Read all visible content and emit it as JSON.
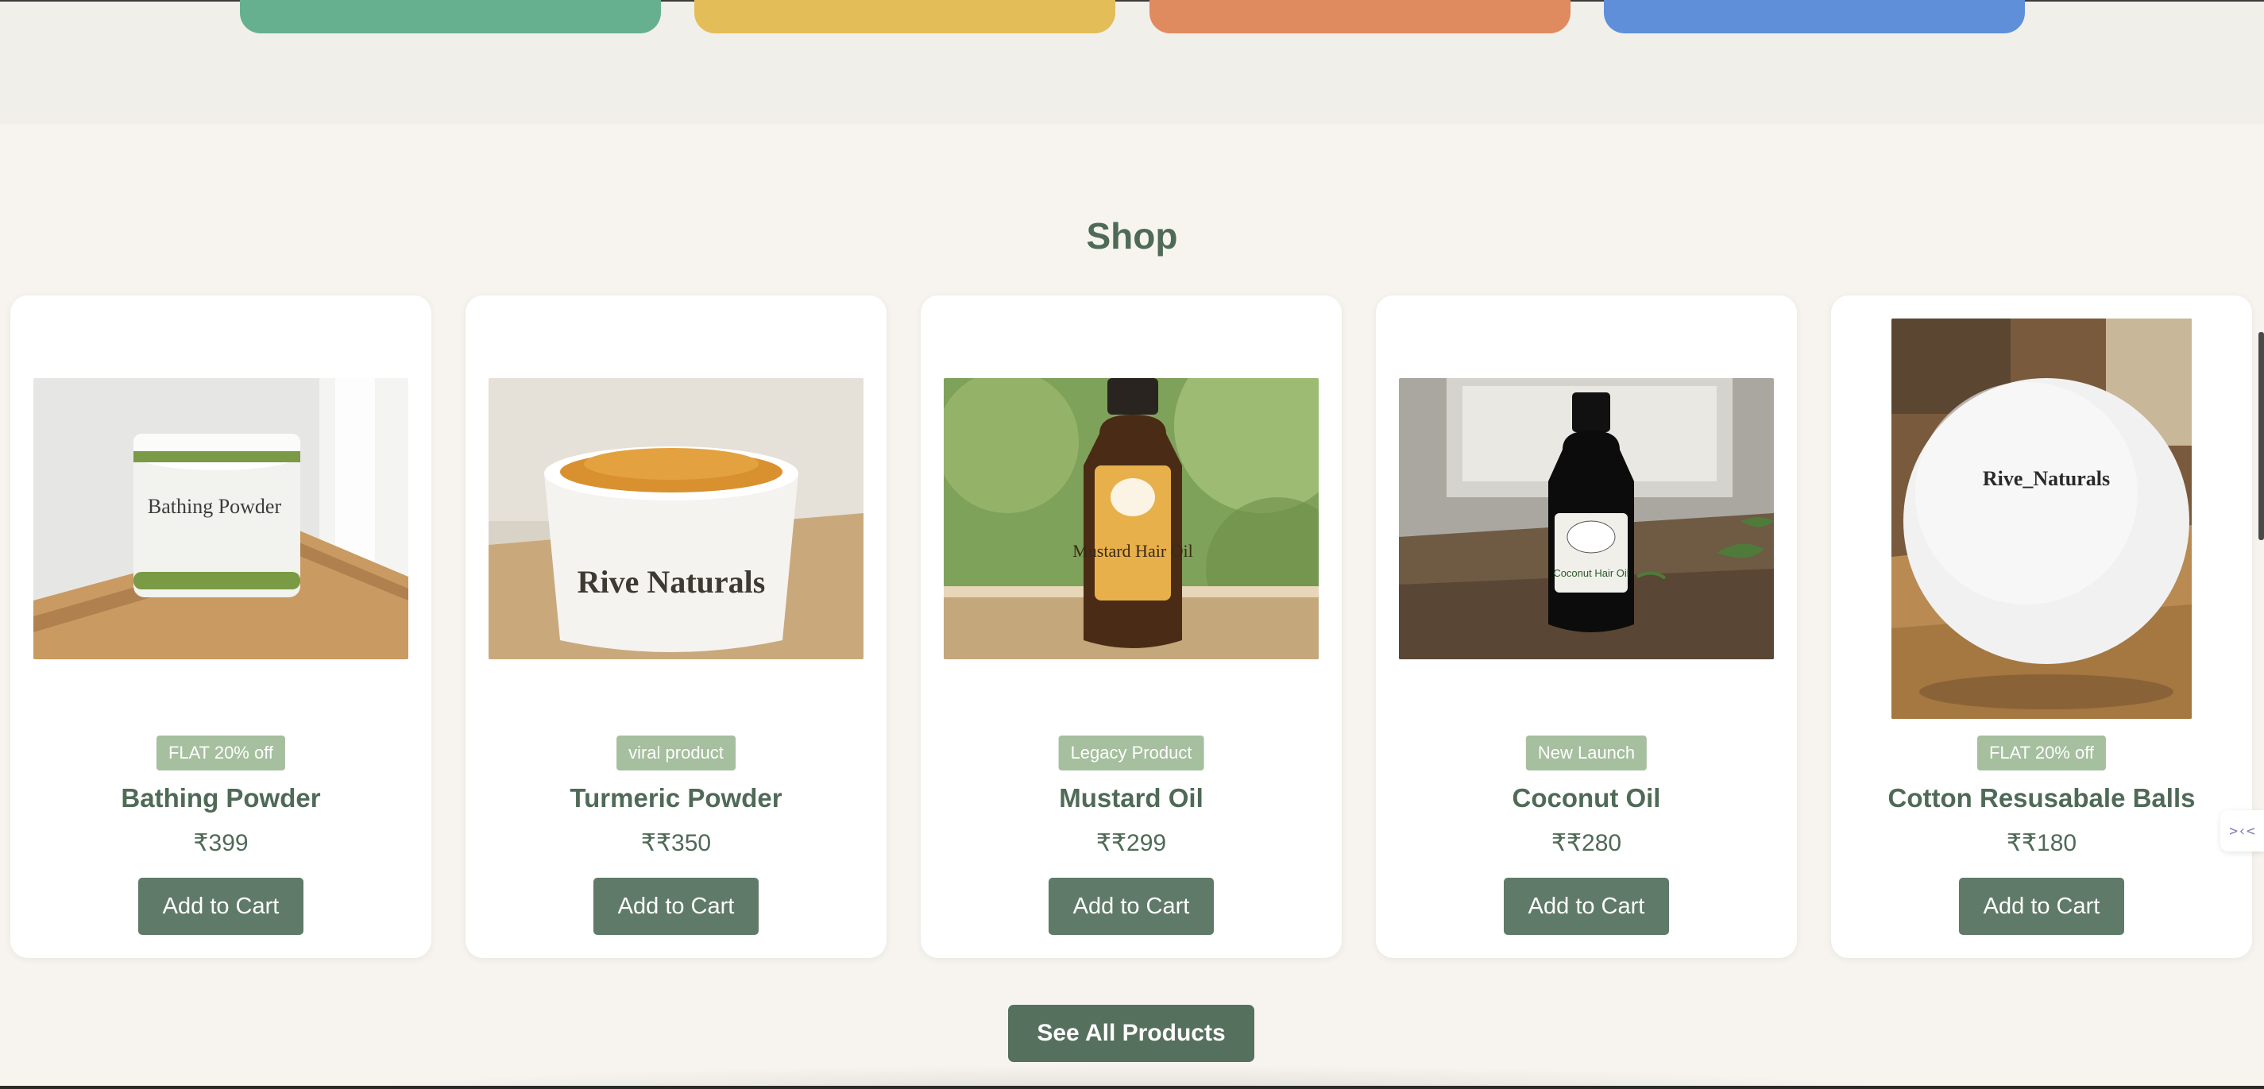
{
  "category_cards": [
    {
      "color": "#66b08f"
    },
    {
      "color": "#e3bd57"
    },
    {
      "color": "#e08a5f"
    },
    {
      "color": "#5f8fd9"
    }
  ],
  "shop": {
    "title": "Shop",
    "products": [
      {
        "name": "Bathing Powder",
        "badge": "FLAT 20% off",
        "price": "₹399",
        "button_label": "Add to Cart",
        "image_icon": "bathing-powder-jar-image",
        "image_label": "Bathing Powder"
      },
      {
        "name": "Turmeric Powder",
        "badge": "viral product",
        "price": "₹₹350",
        "button_label": "Add to Cart",
        "image_icon": "turmeric-powder-jar-image",
        "image_label": "Rive Naturals"
      },
      {
        "name": "Mustard Oil",
        "badge": "Legacy Product",
        "price": "₹₹299",
        "button_label": "Add to Cart",
        "image_icon": "mustard-oil-bottle-image",
        "image_label": "Mustard Hair Oil"
      },
      {
        "name": "Coconut Oil",
        "badge": "New Launch",
        "price": "₹₹280",
        "button_label": "Add to Cart",
        "image_icon": "coconut-oil-bottle-image",
        "image_label": "Coconut Hair Oil"
      },
      {
        "name": "Cotton Resusabale Balls",
        "badge": "FLAT 20% off",
        "price": "₹₹180",
        "button_label": "Add to Cart",
        "image_icon": "cotton-ball-image",
        "image_label": "Rive_Naturals"
      }
    ],
    "see_all_label": "See All Products"
  },
  "side_widget": {
    "icon": "code-toggle-icon",
    "glyph": ">‹<"
  }
}
